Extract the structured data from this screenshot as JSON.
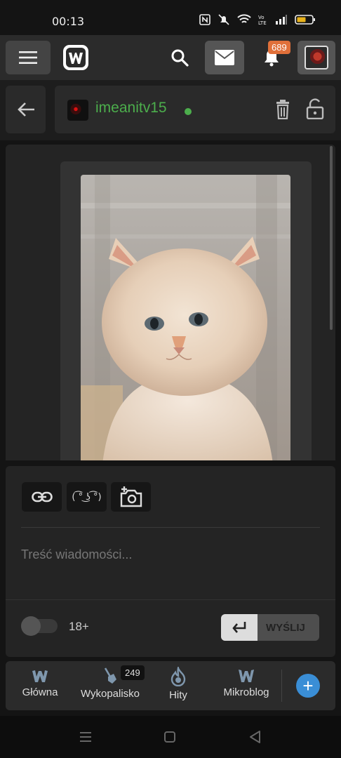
{
  "status_bar": {
    "time": "00:13"
  },
  "topbar": {
    "notifications_count": "689"
  },
  "conversation": {
    "username": "imeanitv15",
    "online": true
  },
  "composer": {
    "lenny_face": "( ͡° ͜ʖ ͡°)",
    "placeholder": "Treść wiadomości...",
    "age_label": "18+",
    "send_label": "WYŚLIJ"
  },
  "bottom_nav": {
    "items": [
      {
        "label": "Główna",
        "icon": "home-w-icon"
      },
      {
        "label": "Wykopalisko",
        "icon": "shovel-icon",
        "badge": "249"
      },
      {
        "label": "Hity",
        "icon": "flame-icon"
      },
      {
        "label": "Mikroblog",
        "icon": "mikroblog-icon"
      }
    ],
    "add_label": "+"
  },
  "colors": {
    "accent_green": "#4cae4c",
    "badge_orange": "#e0703a",
    "add_blue": "#3a8ed6"
  }
}
